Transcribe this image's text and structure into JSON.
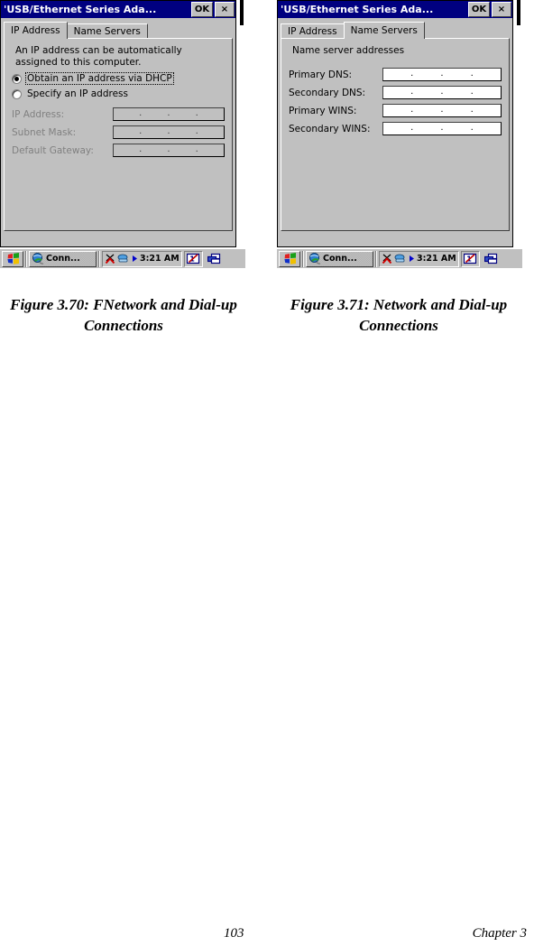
{
  "document": {
    "page_number": "103",
    "chapter_label": "Chapter 3"
  },
  "figures": [
    {
      "caption": "Figure 3.70: FNetwork and Dial-up Connections",
      "window": {
        "title": "'USB/Ethernet Series Ada...",
        "ok_label": "OK",
        "close_label": "×",
        "tabs": [
          {
            "label": "IP Address",
            "active": true
          },
          {
            "label": "Name Servers",
            "active": false
          }
        ],
        "description_line1": "An IP address can be automatically",
        "description_line2": "assigned to this computer.",
        "radios": [
          {
            "label": "Obtain an IP address via DHCP",
            "selected": true,
            "focused": true
          },
          {
            "label": "Specify an IP address",
            "selected": false,
            "focused": false
          }
        ],
        "fields": [
          {
            "label": "IP Address:",
            "value": "",
            "enabled": false
          },
          {
            "label": "Subnet Mask:",
            "value": "",
            "enabled": false
          },
          {
            "label": "Default Gateway:",
            "value": "",
            "enabled": false
          }
        ]
      }
    },
    {
      "caption": "Figure 3.71: Network and Dial-up Connections",
      "window": {
        "title": "'USB/Ethernet Series Ada...",
        "ok_label": "OK",
        "close_label": "×",
        "tabs": [
          {
            "label": "IP Address",
            "active": false
          },
          {
            "label": "Name Servers",
            "active": true
          }
        ],
        "group_title": "Name server addresses",
        "fields": [
          {
            "label": "Primary DNS:",
            "value": "",
            "enabled": true
          },
          {
            "label": "Secondary DNS:",
            "value": "",
            "enabled": true
          },
          {
            "label": "Primary WINS:",
            "value": "",
            "enabled": true
          },
          {
            "label": "Secondary WINS:",
            "value": "",
            "enabled": true
          }
        ]
      }
    }
  ],
  "taskbar": {
    "start_icon": "windows-flag-icon",
    "task_button": {
      "icon": "globe-icon",
      "label": "Conn..."
    },
    "tray": {
      "network_disconnected_icon": "network-disconnected-icon",
      "connection_icon": "connection-icon",
      "speaker_icon": "speaker-arrow-icon",
      "clock": "3:21 AM",
      "input_panel_icon": "input-panel-pen-icon",
      "desktop_icon": "show-desktop-icon"
    }
  },
  "colors": {
    "titlebar": "#000080",
    "face": "#c0c0c0",
    "field_white": "#ffffff",
    "disabled_text": "#808080"
  }
}
